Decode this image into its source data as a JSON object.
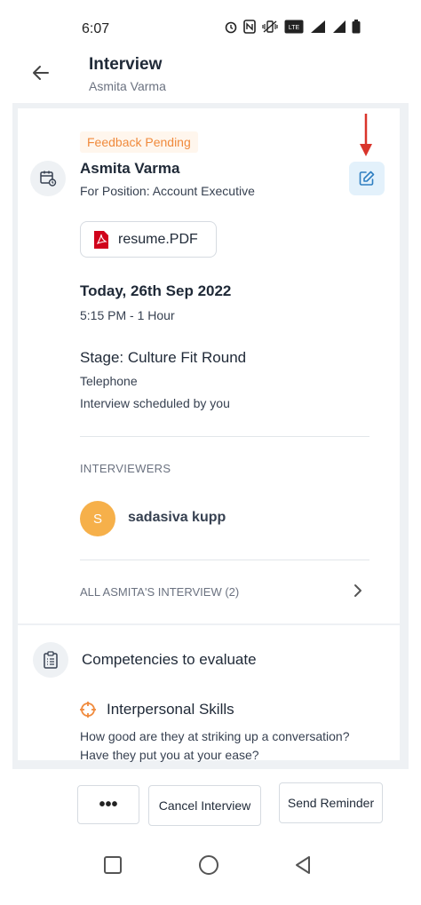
{
  "status_bar": {
    "time": "6:07",
    "icons": [
      "alarm-icon",
      "nfc-icon",
      "vibrate-icon",
      "volte-icon",
      "4g-signal-icon",
      "signal-icon",
      "battery-icon"
    ]
  },
  "header": {
    "title": "Interview",
    "subtitle": "Asmita Varma"
  },
  "interview": {
    "status_badge": "Feedback Pending",
    "candidate_name": "Asmita Varma",
    "position": "For Position: Account Executive",
    "resume_label": "resume.PDF",
    "date": "Today, 26th Sep 2022",
    "time": "5:15 PM - 1 Hour",
    "stage": "Stage: Culture Fit Round",
    "mode": "Telephone",
    "scheduled_by": "Interview scheduled by you"
  },
  "interviewers": {
    "label": "INTERVIEWERS",
    "items": [
      {
        "initial": "S",
        "name": "sadasiva kupp"
      }
    ]
  },
  "all_interviews_link": "ALL ASMITA'S INTERVIEW (2)",
  "competencies": {
    "title": "Competencies to evaluate",
    "skill_title": "Interpersonal Skills",
    "skill_question_line1": "How good are they at striking up a conversation?",
    "skill_question_line2": "Have they put you at your ease?"
  },
  "actions": {
    "more_label": "•••",
    "cancel_label": "Cancel Interview",
    "remind_label": "Send Reminder"
  },
  "colors": {
    "accent_orange": "#f08a3c",
    "avatar_orange": "#f6b04a",
    "edit_bg": "#e3f1fb",
    "edit_icon": "#2f7fc1",
    "annotation_red": "#d9342b",
    "pdf_red": "#d0021b"
  }
}
